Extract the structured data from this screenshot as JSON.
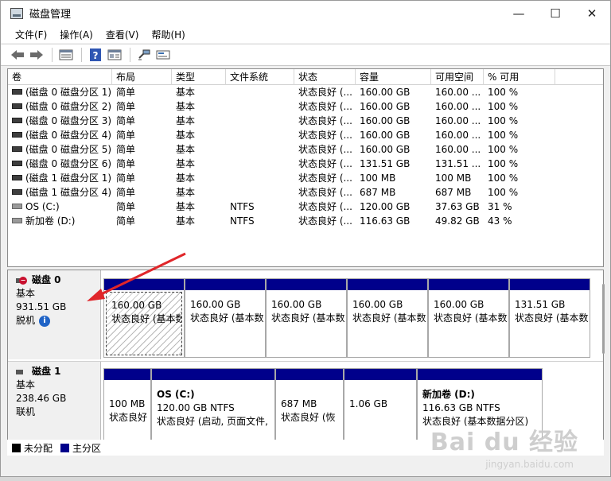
{
  "window": {
    "title": "磁盘管理",
    "controls": {
      "minimize": "—",
      "maximize": "☐",
      "close": "✕"
    }
  },
  "menu": [
    "文件(F)",
    "操作(A)",
    "查看(V)",
    "帮助(H)"
  ],
  "toolbar": {
    "icons": [
      "back-arrow-icon",
      "forward-arrow-icon",
      "list-view-icon",
      "help-icon",
      "properties-icon",
      "connect-icon",
      "disk-icon"
    ]
  },
  "volume_list": {
    "columns": [
      "卷",
      "布局",
      "类型",
      "文件系统",
      "状态",
      "容量",
      "可用空间",
      "% 可用"
    ],
    "rows": [
      [
        "(磁盘 0 磁盘分区 1)",
        "简单",
        "基本",
        "",
        "状态良好 (...",
        "160.00 GB",
        "160.00 ...",
        "100 %"
      ],
      [
        "(磁盘 0 磁盘分区 2)",
        "简单",
        "基本",
        "",
        "状态良好 (...",
        "160.00 GB",
        "160.00 ...",
        "100 %"
      ],
      [
        "(磁盘 0 磁盘分区 3)",
        "简单",
        "基本",
        "",
        "状态良好 (...",
        "160.00 GB",
        "160.00 ...",
        "100 %"
      ],
      [
        "(磁盘 0 磁盘分区 4)",
        "简单",
        "基本",
        "",
        "状态良好 (...",
        "160.00 GB",
        "160.00 ...",
        "100 %"
      ],
      [
        "(磁盘 0 磁盘分区 5)",
        "简单",
        "基本",
        "",
        "状态良好 (...",
        "160.00 GB",
        "160.00 ...",
        "100 %"
      ],
      [
        "(磁盘 0 磁盘分区 6)",
        "简单",
        "基本",
        "",
        "状态良好 (...",
        "131.51 GB",
        "131.51 ...",
        "100 %"
      ],
      [
        "(磁盘 1 磁盘分区 1)",
        "简单",
        "基本",
        "",
        "状态良好 (...",
        "100 MB",
        "100 MB",
        "100 %"
      ],
      [
        "(磁盘 1 磁盘分区 4)",
        "简单",
        "基本",
        "",
        "状态良好 (...",
        "687 MB",
        "687 MB",
        "100 %"
      ],
      [
        "OS (C:)",
        "简单",
        "基本",
        "NTFS",
        "状态良好 (...",
        "120.00 GB",
        "37.63 GB",
        "31 %"
      ],
      [
        "新加卷 (D:)",
        "简单",
        "基本",
        "NTFS",
        "状态良好 (...",
        "116.63 GB",
        "49.82 GB",
        "43 %"
      ]
    ]
  },
  "disks": [
    {
      "name": "磁盘 0",
      "type": "基本",
      "size": "931.51 GB",
      "status": "脱机",
      "partitions": [
        {
          "name": "",
          "size": "160.00 GB",
          "status": "状态良好 (基本数"
        },
        {
          "name": "",
          "size": "160.00 GB",
          "status": "状态良好 (基本数"
        },
        {
          "name": "",
          "size": "160.00 GB",
          "status": "状态良好 (基本数"
        },
        {
          "name": "",
          "size": "160.00 GB",
          "status": "状态良好 (基本数"
        },
        {
          "name": "",
          "size": "160.00 GB",
          "status": "状态良好 (基本数"
        },
        {
          "name": "",
          "size": "131.51 GB",
          "status": "状态良好 (基本数"
        }
      ]
    },
    {
      "name": "磁盘 1",
      "type": "基本",
      "size": "238.46 GB",
      "status": "联机",
      "partitions": [
        {
          "name": "",
          "size": "100 MB",
          "status": "状态良好"
        },
        {
          "name": "OS  (C:)",
          "size": "120.00 GB NTFS",
          "status": "状态良好 (启动, 页面文件,"
        },
        {
          "name": "",
          "size": "687 MB",
          "status": "状态良好 (恢"
        },
        {
          "name": "",
          "size": "1.06 GB",
          "status": ""
        },
        {
          "name": "新加卷  (D:)",
          "size": "116.63 GB NTFS",
          "status": "状态良好 (基本数据分区)"
        }
      ]
    }
  ],
  "legend": [
    {
      "label": "未分配",
      "color": "#000000"
    },
    {
      "label": "主分区",
      "color": "#00008b"
    }
  ],
  "watermark": {
    "text": "Bai du 经验",
    "sub": "jingyan.baidu.com"
  }
}
